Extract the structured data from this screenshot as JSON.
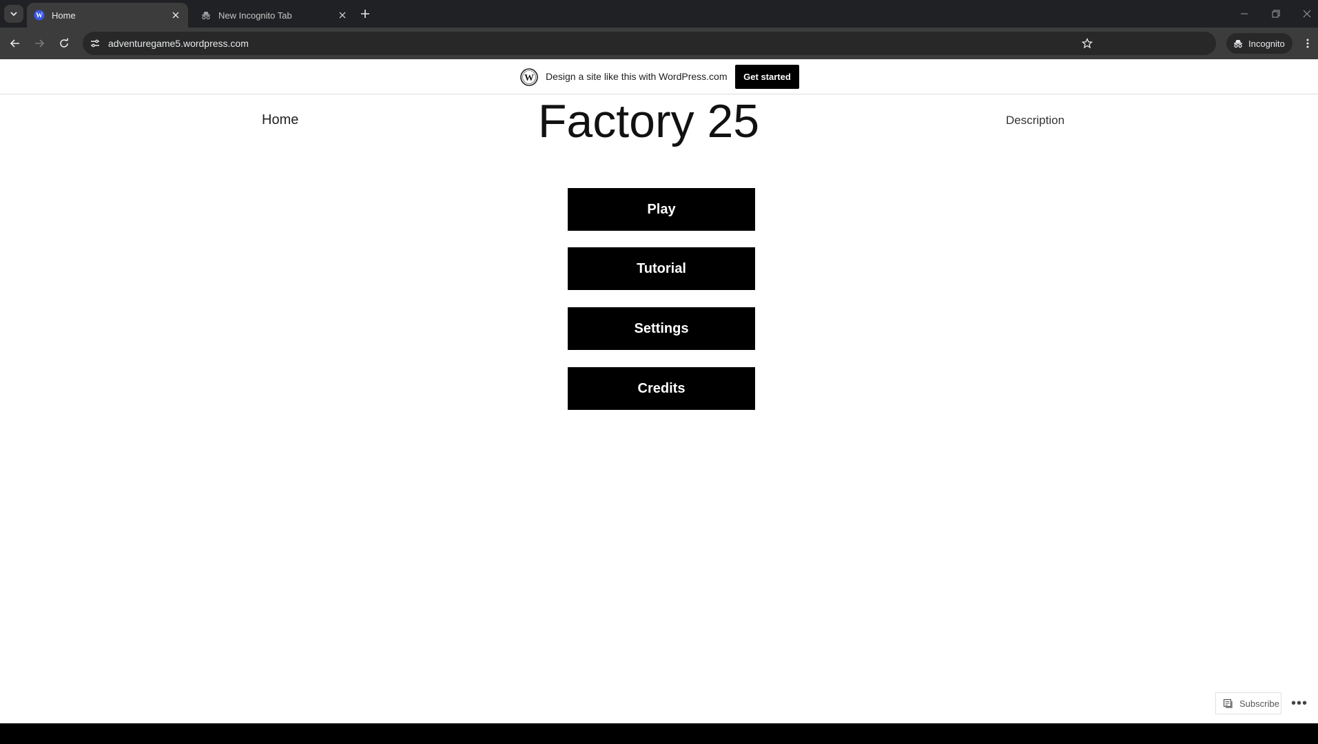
{
  "browser": {
    "tabs": [
      {
        "title": "Home",
        "favicon": "wordpress-icon",
        "active": true
      },
      {
        "title": "New Incognito Tab",
        "favicon": "incognito-icon",
        "active": false
      }
    ],
    "url": "adventuregame5.wordpress.com",
    "profile_label": "Incognito"
  },
  "wp_banner": {
    "text": "Design a site like this with WordPress.com",
    "cta_label": "Get started"
  },
  "site": {
    "nav_left": "Home",
    "title": "Factory 25",
    "nav_right": "Description"
  },
  "menu": {
    "buttons": [
      {
        "label": "Play"
      },
      {
        "label": "Tutorial"
      },
      {
        "label": "Settings"
      },
      {
        "label": "Credits"
      }
    ]
  },
  "footer": {
    "subscribe_label": "Subscribe",
    "more_label": "•••"
  },
  "colors": {
    "chrome_dark": "#202124",
    "toolbar": "#3c3c3c",
    "button_bg": "#000000",
    "button_text": "#ffffff"
  }
}
